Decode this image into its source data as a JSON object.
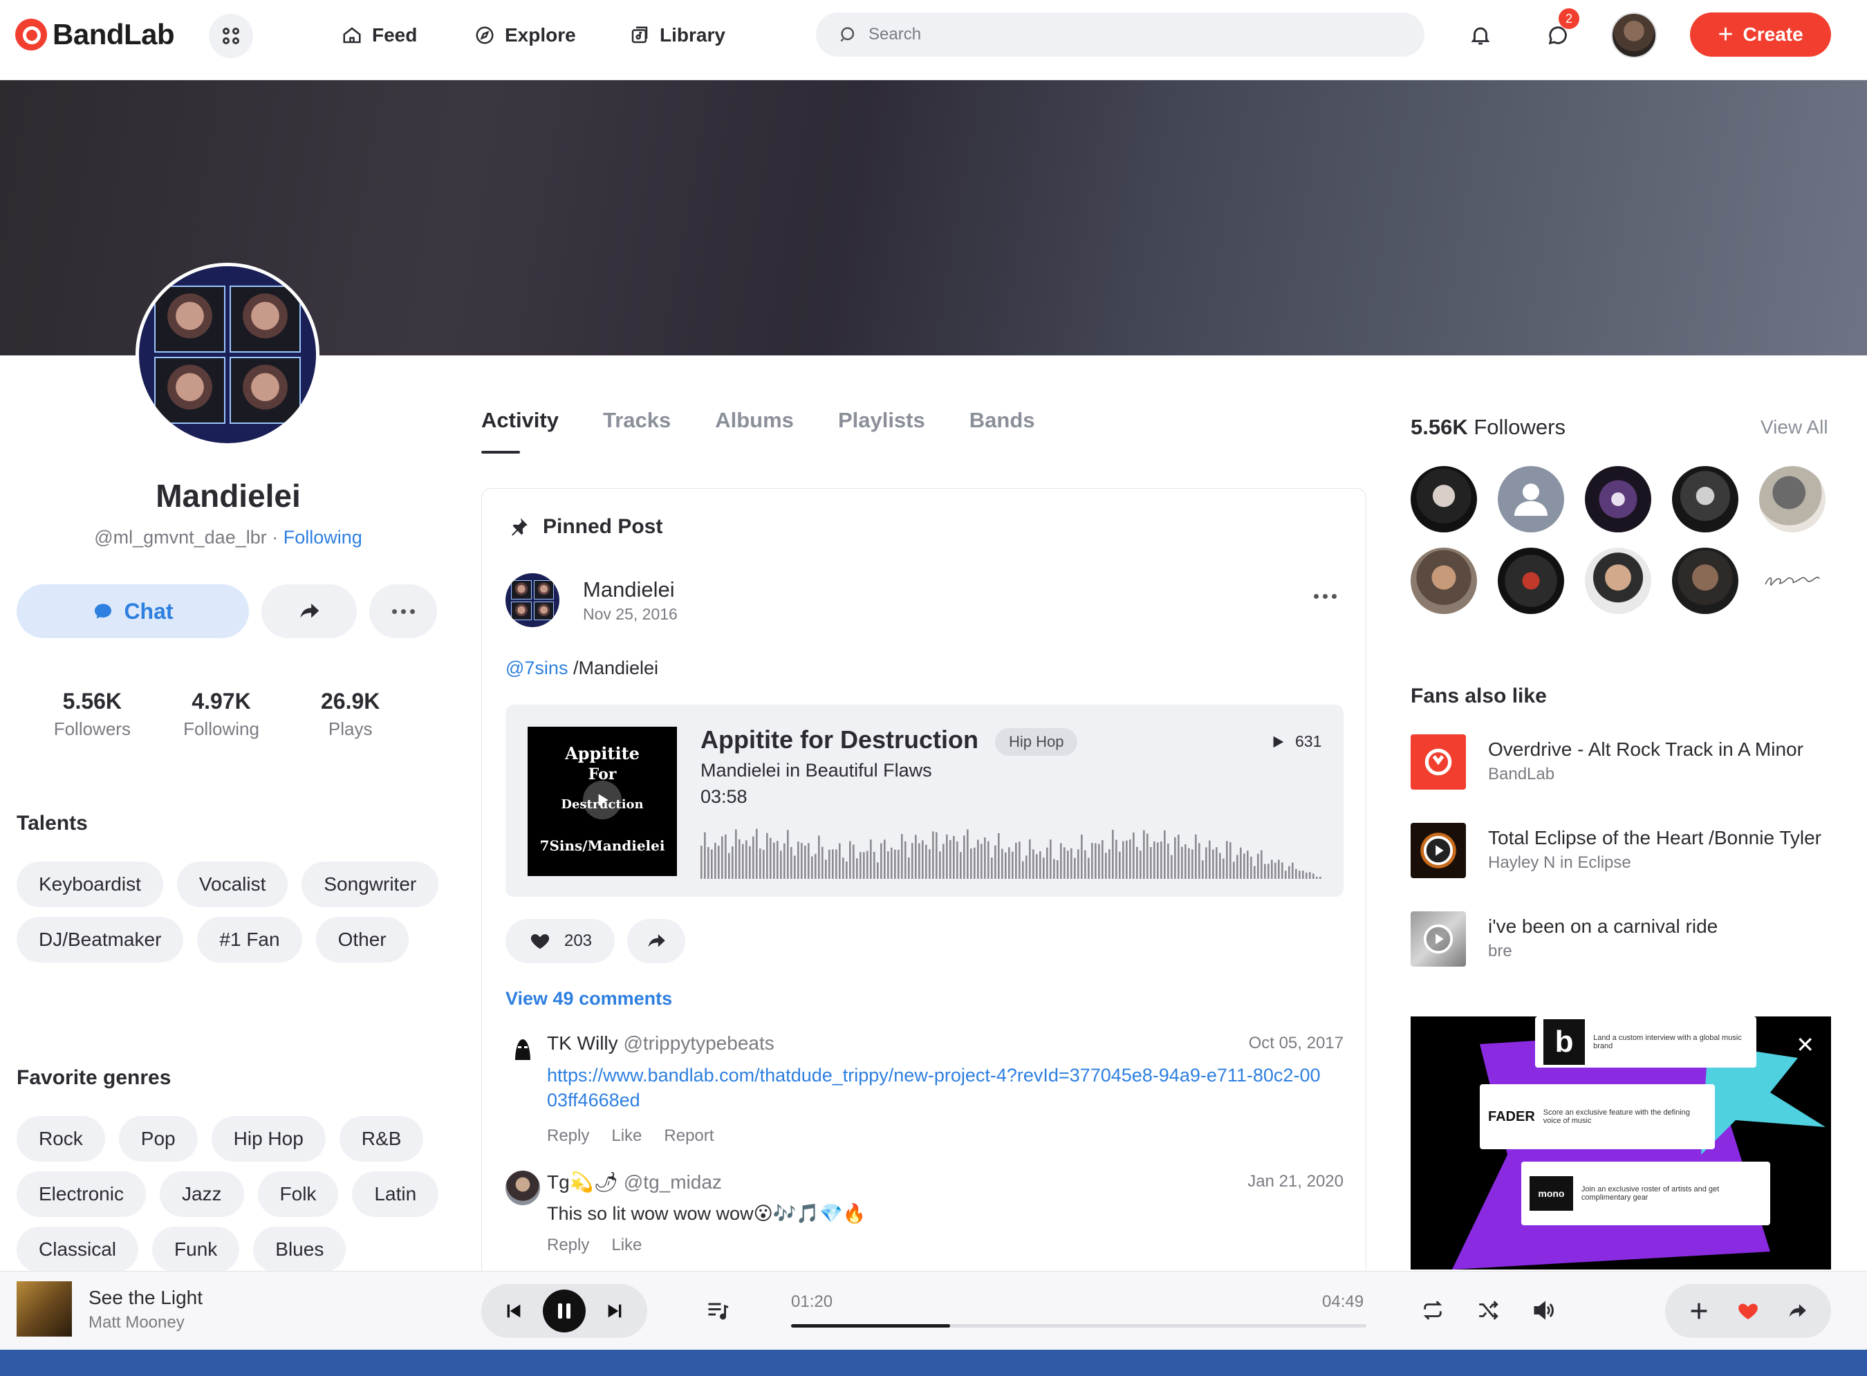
{
  "brand": {
    "name": "BandLab",
    "accent": "#f23e2f",
    "link_color": "#2d7fe0"
  },
  "nav": {
    "feed": "Feed",
    "explore": "Explore",
    "library": "Library",
    "search_placeholder": "Search",
    "messages_badge": "2",
    "create": "Create"
  },
  "profile": {
    "name": "Mandielei",
    "handle": "@ml_gmvnt_dae_lbr",
    "separator": " · ",
    "follow_state": "Following",
    "chat": "Chat",
    "stats": [
      {
        "value": "5.56K",
        "label": "Followers"
      },
      {
        "value": "4.97K",
        "label": "Following"
      },
      {
        "value": "26.9K",
        "label": "Plays"
      }
    ],
    "talents_title": "Talents",
    "talents": [
      "Keyboardist",
      "Vocalist",
      "Songwriter",
      "DJ/Beatmaker",
      "#1 Fan",
      "Other"
    ],
    "genres_title": "Favorite genres",
    "genres": [
      "Rock",
      "Pop",
      "Hip Hop",
      "R&B",
      "Electronic",
      "Jazz",
      "Folk",
      "Latin",
      "Classical",
      "Funk",
      "Blues"
    ]
  },
  "tabs": [
    "Activity",
    "Tracks",
    "Albums",
    "Playlists",
    "Bands"
  ],
  "post": {
    "pinned_label": "Pinned Post",
    "author": "Mandielei",
    "date": "Nov 25, 2016",
    "mention": "@7sins",
    "text": " /Mandielei",
    "track": {
      "cover_lines": [
        "Appitite",
        "For",
        "Destruction",
        "7Sins/Mandielei"
      ],
      "title": "Appitite for Destruction",
      "genre": "Hip Hop",
      "plays": "631",
      "subtitle": "Mandielei in Beautiful Flaws",
      "duration": "03:58"
    },
    "likes": "203",
    "view_comments": "View 49 comments",
    "comments": [
      {
        "name": "TK Willy",
        "handle": "@trippytypebeats",
        "date": "Oct 05, 2017",
        "link": "https://www.bandlab.com/thatdude_trippy/new-project-4?revId=377045e8-94a9-e711-80c2-0003ff4668ed",
        "actions": [
          "Reply",
          "Like",
          "Report"
        ]
      },
      {
        "name": "Tg💫🌶",
        "handle": "@tg_midaz",
        "date": "Jan 21, 2020",
        "text": "This so lit wow wow wow😮🎶🎵💎🔥",
        "actions": [
          "Reply",
          "Like"
        ]
      }
    ]
  },
  "followers": {
    "count": "5.56K",
    "label": " Followers",
    "view_all": "View All"
  },
  "fans_also_like": {
    "title": "Fans also like",
    "items": [
      {
        "title": "Overdrive - Alt Rock Track in A Minor",
        "subtitle": "BandLab"
      },
      {
        "title": "Total Eclipse of the Heart /Bonnie Tyler",
        "subtitle": "Hayley N in Eclipse"
      },
      {
        "title": "i've been on a carnival ride",
        "subtitle": "bre"
      }
    ]
  },
  "ad": {
    "card1": "Land a custom interview with a global music brand",
    "card2": "Score an exclusive feature with the defining voice of music",
    "card3": "Join an exclusive roster of artists and get complimentary gear",
    "logo1": "b",
    "logo2": "FADER",
    "logo3": "mono",
    "close": "✕"
  },
  "player": {
    "title": "See the Light",
    "artist": "Matt Mooney",
    "current_time": "01:20",
    "total_time": "04:49",
    "progress_fraction": 0.277
  }
}
